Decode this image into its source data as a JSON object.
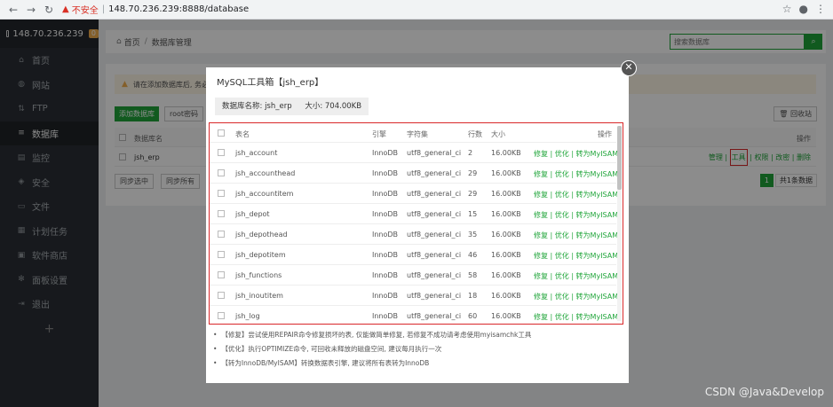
{
  "browser": {
    "insecure_label": "不安全",
    "url": "148.70.236.239:8888/database"
  },
  "sidebar": {
    "server": "148.70.236.239",
    "badge": "0",
    "items": [
      {
        "label": "首页",
        "icon": "home-icon"
      },
      {
        "label": "网站",
        "icon": "globe-icon"
      },
      {
        "label": "FTP",
        "icon": "ftp-icon"
      },
      {
        "label": "数据库",
        "icon": "database-icon"
      },
      {
        "label": "监控",
        "icon": "monitor-icon"
      },
      {
        "label": "安全",
        "icon": "shield-icon"
      },
      {
        "label": "文件",
        "icon": "folder-icon"
      },
      {
        "label": "计划任务",
        "icon": "calendar-icon"
      },
      {
        "label": "软件商店",
        "icon": "store-icon"
      },
      {
        "label": "面板设置",
        "icon": "gear-icon"
      },
      {
        "label": "退出",
        "icon": "logout-icon"
      }
    ],
    "add_label": "+"
  },
  "breadcrumb": {
    "home": "首页",
    "sep": "/",
    "current": "数据库管理"
  },
  "search": {
    "placeholder": "搜索数据库"
  },
  "panel": {
    "warning": "请在添加数据库后, 务必...",
    "add_btn": "添加数据库",
    "root_btn": "root密码",
    "recycle_btn": "回收站",
    "col_name": "数据库名",
    "col_ops": "操作",
    "row_name": "jsh_erp",
    "row_ops": [
      "管理",
      "工具",
      "权限",
      "改密",
      "删除"
    ],
    "sync_selected": "同步选中",
    "sync_all": "同步所有",
    "page": "1",
    "total": "共1条数据"
  },
  "modal": {
    "title": "MySQL工具箱【jsh_erp】",
    "db_label": "数据库名称: jsh_erp",
    "size_label": "大小: 704.00KB",
    "columns": [
      "表名",
      "引擎",
      "字符集",
      "行数",
      "大小",
      "操作"
    ],
    "rows": [
      {
        "name": "jsh_account",
        "engine": "InnoDB",
        "charset": "utf8_general_ci",
        "rows": "2",
        "size": "16.00KB"
      },
      {
        "name": "jsh_accounthead",
        "engine": "InnoDB",
        "charset": "utf8_general_ci",
        "rows": "29",
        "size": "16.00KB"
      },
      {
        "name": "jsh_accountitem",
        "engine": "InnoDB",
        "charset": "utf8_general_ci",
        "rows": "29",
        "size": "16.00KB"
      },
      {
        "name": "jsh_depot",
        "engine": "InnoDB",
        "charset": "utf8_general_ci",
        "rows": "15",
        "size": "16.00KB"
      },
      {
        "name": "jsh_depothead",
        "engine": "InnoDB",
        "charset": "utf8_general_ci",
        "rows": "35",
        "size": "16.00KB"
      },
      {
        "name": "jsh_depotitem",
        "engine": "InnoDB",
        "charset": "utf8_general_ci",
        "rows": "46",
        "size": "16.00KB"
      },
      {
        "name": "jsh_functions",
        "engine": "InnoDB",
        "charset": "utf8_general_ci",
        "rows": "58",
        "size": "16.00KB"
      },
      {
        "name": "jsh_inoutitem",
        "engine": "InnoDB",
        "charset": "utf8_general_ci",
        "rows": "18",
        "size": "16.00KB"
      },
      {
        "name": "jsh_log",
        "engine": "InnoDB",
        "charset": "utf8_general_ci",
        "rows": "60",
        "size": "16.00KB"
      }
    ],
    "row_ops": "修复 | 优化 | 转为MyISAM",
    "notes": [
      "【修复】尝试使用REPAIR命令修复损坏的表, 仅能做简单修复, 若修复不成功请考虑使用myisamchk工具",
      "【优化】执行OPTIMIZE命令, 可回收未释放的磁盘空间, 建议每月执行一次",
      "【转为InnoDB/MyISAM】转换数据表引擎, 建议将所有表转为InnoDB"
    ]
  },
  "watermark": "CSDN @Java&Develop"
}
